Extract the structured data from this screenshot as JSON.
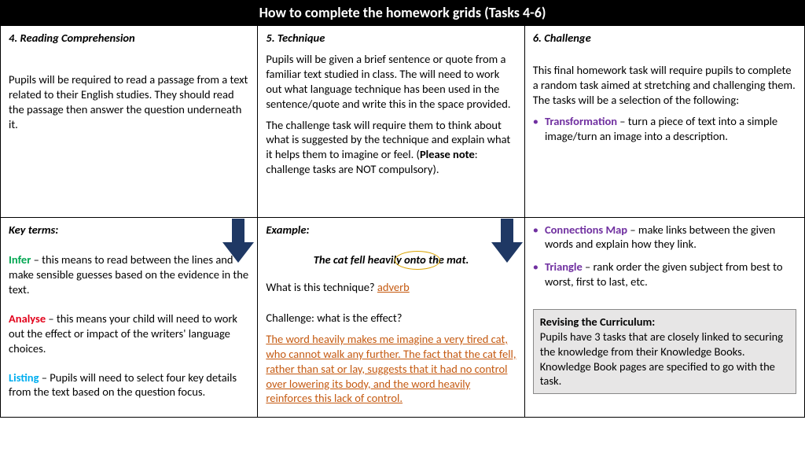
{
  "title": "How to complete the homework grids (Tasks 4-6)",
  "cells": {
    "c4": {
      "heading": "4. Reading Comprehension",
      "body": "Pupils will be required to read a passage from a text related to their English studies. They should read the passage then answer the question underneath it."
    },
    "c5": {
      "heading": "5. Technique",
      "p1": "Pupils will be given a brief sentence or quote from a familiar text studied in class. The will need to work out what language technique has been used in the sentence/quote and write this in the space provided.",
      "p2a": "The challenge task will require them to think about what is suggested by the technique and explain what it helps them to imagine or feel. (",
      "p2b": "Please note",
      "p2c": ": challenge tasks are NOT compulsory)."
    },
    "c6": {
      "heading": "6. Challenge",
      "intro": "This final homework task will require pupils to complete a random task aimed at stretching and challenging them. The tasks will be a selection of the following:",
      "b1t": "Transformation",
      "b1d": " – turn a piece of text into a simple image/turn an image into a description.",
      "b2t": "Connections Map",
      "b2d": " – make links between the given words and explain how they link.",
      "b3t": "Triangle",
      "b3d": " – rank order the given subject from best to worst, first to last, etc."
    },
    "keyterms": {
      "heading": "Key terms:",
      "t1": "Infer",
      "d1": " – this means to read between the lines and make sensible guesses based on the evidence in the text.",
      "t2": "Analyse",
      "d2": " – this means your child will need to work out the effect or impact of the writers' language choices.",
      "t3": "Listing",
      "d3": " – Pupils will need to select four key details from the text based on the question focus."
    },
    "example": {
      "heading": "Example:",
      "sentence": "The cat fell heavily onto the mat.",
      "q1": "What is this technique? ",
      "a1": "adverb",
      "q2": "Challenge: what is the effect?",
      "a2": "The word heavily makes me imagine a very tired cat, who cannot walk any further. The fact that the cat fell, rather than sat or lay, suggests that it had no control over lowering its body, and the word heavily reinforces this lack of control."
    },
    "rev": {
      "heading": "Revising the Curriculum:",
      "body": "Pupils have 3 tasks that are closely linked to securing the knowledge from their Knowledge Books. Knowledge Book pages are specified to go with the task."
    }
  }
}
